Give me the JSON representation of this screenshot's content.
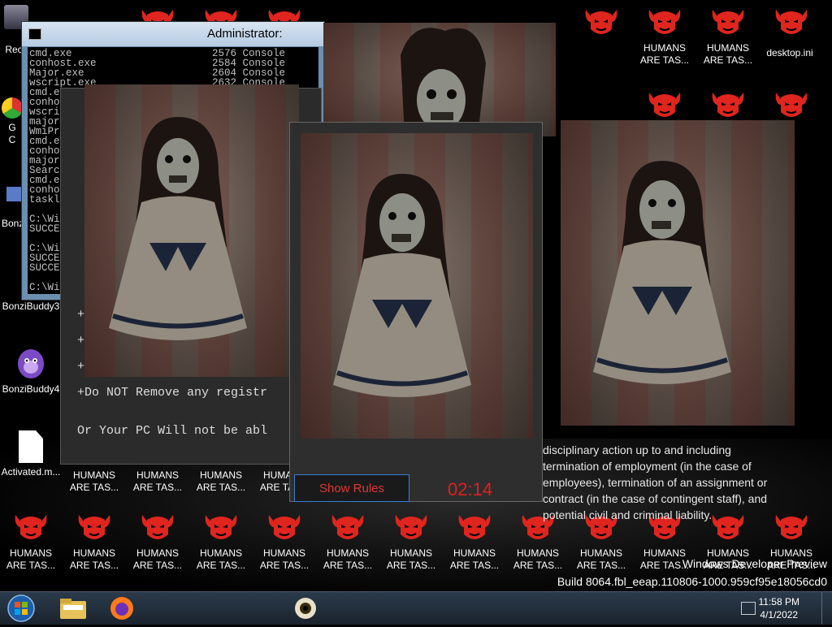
{
  "desktop": {
    "recycle_label": "Recy",
    "chrome_label": "G\nC",
    "bonzi1_label": "Bonzi",
    "bonzi3_label": "BonziBuddy3",
    "bonzi4_label": "BonziBuddy4",
    "activated_label": "Activated.m...",
    "humans_label_1": "HUMANS",
    "humans_label_2": "ARE TAS...",
    "ini_label": "desktop.ini",
    "ini_label_2": "op.ini",
    "ns_label_1": "NS",
    "ns_label_2": "AS..."
  },
  "cmd_window": {
    "title": "Administrator: Comma",
    "lines": "cmd.exe                       2576 Console\nconhost.exe                   2584 Console\nMajor.exe                     2604 Console\nwscript.exe                   2632 Console\ncmd.exe\nconhost.e\nwscript.e\nmajorlist\nWmiPrvSE.\ncmd.exe\nconhost.e\nmajordare\nSearchInd\ncmd.exe\nconhost.e\ntasklist.\n\nC:\\Window\nSUCCESS:\n\nC:\\Window\nSUCCESS:\nSUCCESS:\n\nC:\\Window"
  },
  "rules_window": {
    "plus1": "+",
    "plus2": "+",
    "plus3": "+",
    "line_registry": "+Do NOT Remove any registr",
    "line_pc": "Or Your PC Will not be abl"
  },
  "timer_window": {
    "show_rules_label": "Show Rules",
    "timer": "02:14"
  },
  "policy_text": "disciplinary action up to and including termination of employment (in the case of employees), termination of an assignment or contract (in the case of contingent staff), and potential civil and criminal liability.",
  "watermark": {
    "line1": "Windows Developer Preview",
    "line2": "Build 8064.fbl_eeap.110806-1000.959cf95e18056cd0"
  },
  "taskbar": {
    "start_icon": "windows-orb-icon",
    "explorer_icon": "folder-icon",
    "firefox_icon": "firefox-icon",
    "eye_icon": "eyeball-icon",
    "time": "11:58 PM",
    "date": "4/1/2022"
  },
  "colors": {
    "devil_red": "#e0251f",
    "timer_red": "#e02020",
    "taskbar": "#1f2a36"
  }
}
